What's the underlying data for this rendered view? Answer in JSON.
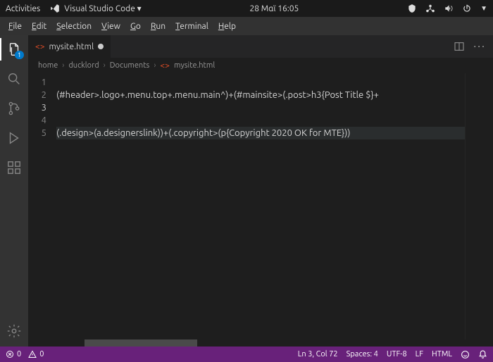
{
  "topbar": {
    "activities": "Activities",
    "app": "Visual Studio Code ▾",
    "datetime": "28 Μαϊ  16:05"
  },
  "menubar": [
    "File",
    "Edit",
    "Selection",
    "View",
    "Go",
    "Run",
    "Terminal",
    "Help"
  ],
  "activity": {
    "badge": "1"
  },
  "tab": {
    "filename": "mysite.html"
  },
  "breadcrumbs": {
    "seg1": "home",
    "seg2": "ducklord",
    "seg3": "Documents",
    "seg4": "mysite.html"
  },
  "code": {
    "l1": "(#header>.logo+.menu.top+.menu.main^)+(#mainsite>(.post>h3{Post Title $}+",
    "l2": "",
    "l3": "(.design>(a.designerslink))+(.copyright>(p{Copyright 2020 OK for MTE}))",
    "l4": "",
    "l5": ""
  },
  "status": {
    "errors": "0",
    "warnings": "0",
    "lncol": "Ln 3, Col 72",
    "spaces": "Spaces: 4",
    "encoding": "UTF-8",
    "eol": "LF",
    "lang": "HTML"
  }
}
